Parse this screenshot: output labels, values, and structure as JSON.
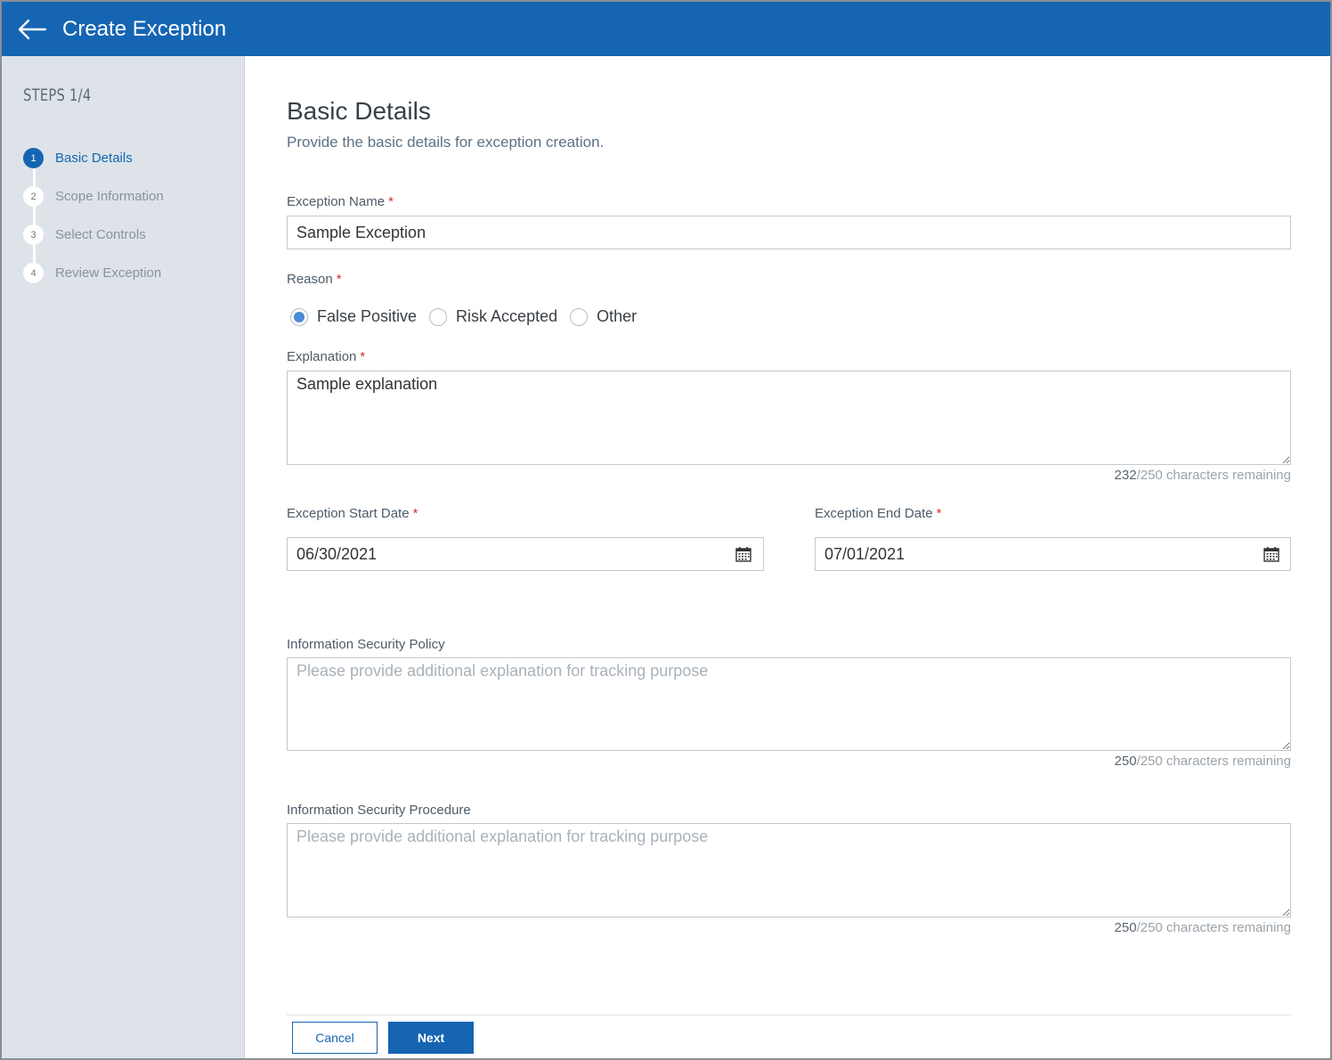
{
  "header": {
    "title": "Create Exception"
  },
  "sidebar": {
    "steps_label": "STEPS 1/4",
    "steps": [
      {
        "num": "1",
        "label": "Basic Details",
        "active": true
      },
      {
        "num": "2",
        "label": "Scope Information",
        "active": false
      },
      {
        "num": "3",
        "label": "Select Controls",
        "active": false
      },
      {
        "num": "4",
        "label": "Review Exception",
        "active": false
      }
    ]
  },
  "main": {
    "title": "Basic Details",
    "subtitle": "Provide the basic details for exception creation.",
    "exception_name": {
      "label": "Exception Name",
      "required": "*",
      "value": "Sample Exception"
    },
    "reason": {
      "label": "Reason",
      "required": "*",
      "options": [
        {
          "label": "False Positive",
          "checked": true
        },
        {
          "label": "Risk Accepted",
          "checked": false
        },
        {
          "label": "Other",
          "checked": false
        }
      ]
    },
    "explanation": {
      "label": "Explanation",
      "required": "*",
      "value": "Sample explanation",
      "remaining": "232",
      "max_suffix": "/250 characters remaining"
    },
    "start_date": {
      "label": "Exception Start Date",
      "required": "*",
      "value": "06/30/2021"
    },
    "end_date": {
      "label": "Exception End Date",
      "required": "*",
      "value": "07/01/2021"
    },
    "policy": {
      "label": "Information Security Policy",
      "placeholder": "Please provide additional explanation for tracking purpose",
      "remaining": "250",
      "max_suffix": "/250 characters remaining"
    },
    "procedure": {
      "label": "Information Security Procedure",
      "placeholder": "Please provide additional explanation for tracking purpose",
      "remaining": "250",
      "max_suffix": "/250 characters remaining"
    }
  },
  "footer": {
    "cancel_label": "Cancel",
    "next_label": "Next"
  },
  "colors": {
    "primary": "#1565b3",
    "sidebar_bg": "#dde3e8",
    "required": "#d32f2f",
    "radio_checked": "#4a8ad6"
  }
}
